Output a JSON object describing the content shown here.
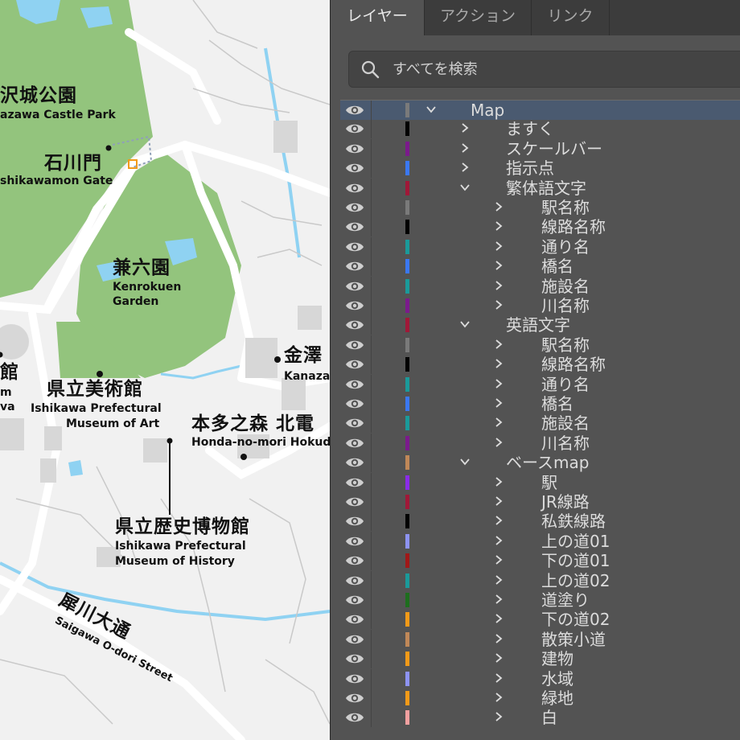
{
  "map": {
    "labels": [
      {
        "name": "kanazawa-castle-park-ja",
        "text": "沢城公園",
        "cls": "ja"
      },
      {
        "name": "kanazawa-castle-park-en",
        "text": "azawa Castle Park",
        "cls": "en"
      },
      {
        "name": "ishikawamon-ja",
        "text": "石川門",
        "cls": "ja"
      },
      {
        "name": "ishikawamon-en",
        "text": "shikawamon Gate",
        "cls": "en"
      },
      {
        "name": "kenrokuen-ja",
        "text": "兼六園",
        "cls": "ja"
      },
      {
        "name": "kenrokuen-en-1",
        "text": "Kenrokuen",
        "cls": "en"
      },
      {
        "name": "kenrokuen-en-2",
        "text": "Garden",
        "cls": "en"
      },
      {
        "name": "art-museum-ja",
        "text": "県立美術館",
        "cls": "ja"
      },
      {
        "name": "art-museum-en-1",
        "text": "Ishikawa Prefectural",
        "cls": "en"
      },
      {
        "name": "art-museum-en-2",
        "text": "Museum of Art",
        "cls": "en"
      },
      {
        "name": "kanazawa-ja",
        "text": "金澤",
        "cls": "ja"
      },
      {
        "name": "kanazawa-en",
        "text": "Kanaza",
        "cls": "en"
      },
      {
        "name": "honda-no-mori-ja",
        "text": "本多之森  北電",
        "cls": "ja"
      },
      {
        "name": "honda-no-mori-en",
        "text": "Honda-no-mori Hokud",
        "cls": "en"
      },
      {
        "name": "history-museum-ja",
        "text": "県立歴史博物館",
        "cls": "ja"
      },
      {
        "name": "history-museum-en-1",
        "text": "Ishikawa Prefectural",
        "cls": "en"
      },
      {
        "name": "history-museum-en-2",
        "text": "Museum of History",
        "cls": "en"
      },
      {
        "name": "saigawa-ja",
        "text": "犀川大通",
        "cls": "ja"
      },
      {
        "name": "saigawa-en",
        "text": "Saigawa O-dori Street",
        "cls": "en"
      },
      {
        "name": "left-edge-ja",
        "text": "館",
        "cls": "ja"
      },
      {
        "name": "left-edge-en-1",
        "text": "m",
        "cls": "en"
      },
      {
        "name": "left-edge-en-2",
        "text": "va",
        "cls": "en"
      }
    ]
  },
  "panel": {
    "tabs": [
      {
        "label": "レイヤー",
        "active": true
      },
      {
        "label": "アクション",
        "active": false
      },
      {
        "label": "リンク",
        "active": false
      }
    ],
    "search": {
      "placeholder": "すべてを検索"
    },
    "layers": [
      {
        "name": "Map",
        "color": "#7a7a7a",
        "level": 0,
        "expanded": true,
        "selected": true
      },
      {
        "name": "ますく",
        "color": "#000000",
        "level": 1,
        "expanded": false
      },
      {
        "name": "スケールバー",
        "color": "#7b1a8c",
        "level": 1,
        "expanded": false
      },
      {
        "name": "指示点",
        "color": "#3a78f2",
        "level": 1,
        "expanded": false
      },
      {
        "name": "繁体語文字",
        "color": "#a01838",
        "level": 1,
        "expanded": true
      },
      {
        "name": "駅名称",
        "color": "#7a7a7a",
        "level": 2,
        "expanded": false
      },
      {
        "name": "線路名称",
        "color": "#000000",
        "level": 2,
        "expanded": false
      },
      {
        "name": "通り名",
        "color": "#1a9a9a",
        "level": 2,
        "expanded": false
      },
      {
        "name": "橋名",
        "color": "#3a78f2",
        "level": 2,
        "expanded": false
      },
      {
        "name": "施設名",
        "color": "#1a9a9a",
        "level": 2,
        "expanded": false
      },
      {
        "name": "川名称",
        "color": "#7b1a8c",
        "level": 2,
        "expanded": false
      },
      {
        "name": "英語文字",
        "color": "#a01838",
        "level": 1,
        "expanded": true
      },
      {
        "name": "駅名称",
        "color": "#7a7a7a",
        "level": 2,
        "expanded": false
      },
      {
        "name": "線路名称",
        "color": "#000000",
        "level": 2,
        "expanded": false
      },
      {
        "name": "通り名",
        "color": "#1a9a9a",
        "level": 2,
        "expanded": false
      },
      {
        "name": "橋名",
        "color": "#3a78f2",
        "level": 2,
        "expanded": false
      },
      {
        "name": "施設名",
        "color": "#1a9a9a",
        "level": 2,
        "expanded": false
      },
      {
        "name": "川名称",
        "color": "#7b1a8c",
        "level": 2,
        "expanded": false
      },
      {
        "name": "ベースmap",
        "color": "#c08858",
        "level": 1,
        "expanded": true
      },
      {
        "name": "駅",
        "color": "#8a2be8",
        "level": 2,
        "expanded": false
      },
      {
        "name": "JR線路",
        "color": "#a01838",
        "level": 2,
        "expanded": false
      },
      {
        "name": "私鉄線路",
        "color": "#000000",
        "level": 2,
        "expanded": false
      },
      {
        "name": "上の道01",
        "color": "#8d93f2",
        "level": 2,
        "expanded": false
      },
      {
        "name": "下の道01",
        "color": "#a01818",
        "level": 2,
        "expanded": false
      },
      {
        "name": "上の道02",
        "color": "#1a9a9a",
        "level": 2,
        "expanded": false
      },
      {
        "name": "道塗り",
        "color": "#1e6e1e",
        "level": 2,
        "expanded": false
      },
      {
        "name": "下の道02",
        "color": "#f29a18",
        "level": 2,
        "expanded": false
      },
      {
        "name": "散策小道",
        "color": "#c08858",
        "level": 2,
        "expanded": false
      },
      {
        "name": "建物",
        "color": "#f29a18",
        "level": 2,
        "expanded": false
      },
      {
        "name": "水域",
        "color": "#8d93f2",
        "level": 2,
        "expanded": false
      },
      {
        "name": "緑地",
        "color": "#f29a18",
        "level": 2,
        "expanded": false
      },
      {
        "name": "白",
        "color": "#f2a0a0",
        "level": 2,
        "expanded": false
      }
    ]
  }
}
